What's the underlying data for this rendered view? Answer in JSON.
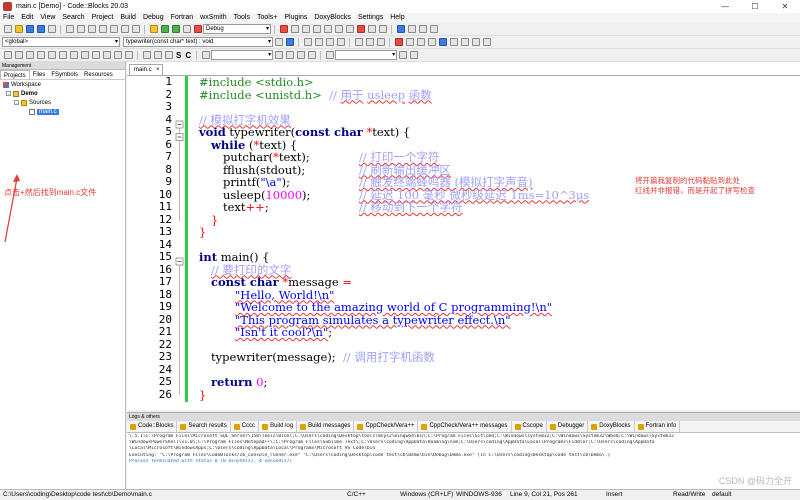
{
  "window": {
    "title": "main.c [Demo] - Code::Blocks 20.03"
  },
  "menu": [
    "File",
    "Edit",
    "View",
    "Search",
    "Project",
    "Build",
    "Debug",
    "Fortran",
    "wxSmith",
    "Tools",
    "Tools+",
    "Plugins",
    "DoxyBlocks",
    "Settings",
    "Help"
  ],
  "toolbar": {
    "build_target": "Debug",
    "scope": "<global>",
    "function": "typewriter(const char* text) : void"
  },
  "management": {
    "title": "Management",
    "tabs": [
      "Projects",
      "Files",
      "FSymbols",
      "Resources"
    ],
    "tree": {
      "workspace": "Workspace",
      "project": "Demo",
      "folder": "Sources",
      "file": "main.c"
    },
    "annotation": "点击+然后找到main.c文件"
  },
  "editor": {
    "tab": "main.c",
    "line_numbers": [
      "1",
      "2",
      "3",
      "4",
      "5",
      "6",
      "7",
      "8",
      "9",
      "10",
      "11",
      "12",
      "13",
      "14",
      "15",
      "16",
      "17",
      "18",
      "19",
      "20",
      "21",
      "22",
      "23",
      "24",
      "25",
      "26"
    ],
    "code": {
      "l1_pp": "#include <stdio.h>",
      "l2_pp": "#include <unistd.h>",
      "l2_c1": "//",
      "l2_c2": "用于",
      "l2_c3": "usleep",
      "l2_c4": "函数",
      "l4_c": "// 模拟打字机效果",
      "l5_kw1": "void",
      "l5_t1": " typewriter(",
      "l5_kw2": "const char",
      "l5_op": " *",
      "l5_t2": "text) {",
      "l6_kw": "while",
      "l6_t1": " (",
      "l6_op": "*",
      "l6_t2": "text) {",
      "l7_t1": "putchar(",
      "l7_op": "*",
      "l7_t2": "text);",
      "l7_c": "// 打印一个字符",
      "l8_t": "fflush(stdout);",
      "l8_c": "// 刷新输出缓冲区",
      "l9_t1": "printf(",
      "l9_s": "\"\\a\"",
      "l9_t2": ");",
      "l9_c": "// 触发终端蜂鸣器 (模拟打字声音)",
      "l10_t1": "usleep(",
      "l10_n": "10000",
      "l10_t2": ");",
      "l10_c": "// 延迟 100 毫秒 微秒级延迟 1ms=10^3μs",
      "l11_t1": "text",
      "l11_op": "++",
      "l11_t2": ";",
      "l11_c": "// 移动到下一个字符",
      "l12_t": "}",
      "l13_t": "}",
      "l15_kw": "int",
      "l15_t": " main() {",
      "l16_c": "// 要打印的文字",
      "l17_kw": "const char",
      "l17_op": " *",
      "l17_t1": "message ",
      "l17_op2": "=",
      "l18_s": "\"Hello, World!\\n\"",
      "l19_s": "\"Welcome to the amazing world of C programming!\\n\"",
      "l20_s": "\"This program simulates a typewriter effect.\\n\"",
      "l21_s": "\"Isn't it cool?\\n\"",
      "l21_t": ";",
      "l23_t": "typewriter(message);",
      "l23_c": "// 调用打字机函数",
      "l25_kw": "return",
      "l25_n": " 0",
      "l25_t": ";",
      "l26_t": "}"
    },
    "annotation_right_1": "将开篇我复制的代码黏贴到此处",
    "annotation_right_2": "红线并非报错，而是开起了拼写检查"
  },
  "logs": {
    "title": "Logs & others",
    "tabs": [
      "Code::Blocks",
      "Search results",
      "Cccc",
      "Build log",
      "Build messages",
      "CppCheck/Vera++",
      "CppCheck/Vera++ messages",
      "Cscope",
      "Debugger",
      "DoxyBlocks",
      "Fortran info"
    ],
    "active_tab": "Build log",
    "lines": [
      "\\.5.1\\C:\\Program Files\\Microsoft SQL Server\\150\\Tools\\Binn\\;C:\\Users\\coding\\Desktop\\tools\\msys2\\mingw64\\bin;C:\\Program Files\\Git\\cmd;C:\\Windows\\system32;C:\\Windows\\System32\\Wbem;C:\\Windows\\System32",
      "\\WindowsPowerShell\\v1.0\\;C:\\Program Files\\Notepad++\\;C:\\Program Files\\Sublime Text\\;C:\\Users\\coding\\AppData\\Roaming\\nvm;C:\\Users\\coding\\AppData\\Local\\Programs\\Fiddler;C:\\Users\\coding\\AppData",
      "\\Local\\Microsoft\\WindowsApps;C:\\Users\\coding\\AppData\\Local\\Programs\\Microsoft VS Code\\bin",
      "Executing: \"C:\\Program Files\\CodeBlocks/cb_console_runner.exe\" \"C:\\Users\\coding\\Desktop\\code test\\cb\\Demo\\bin\\Debug\\Demo.exe\"  (in C:\\Users\\coding\\Desktop\\code test\\cb\\Demo\\.)",
      "Process terminated with status 0 (0 minute(s), 4 second(s))"
    ]
  },
  "status": {
    "path": "C:\\Users\\coding\\Desktop\\code test\\cb\\Demo\\main.c",
    "lang": "C/C++",
    "eol": "Windows (CR+LF)",
    "encoding": "WINDOWS-936",
    "position": "Line 9, Col 21, Pos 261",
    "mode": "Insert",
    "access": "Read/Write",
    "profile": "default"
  },
  "watermark": "CSDN @码力全开"
}
